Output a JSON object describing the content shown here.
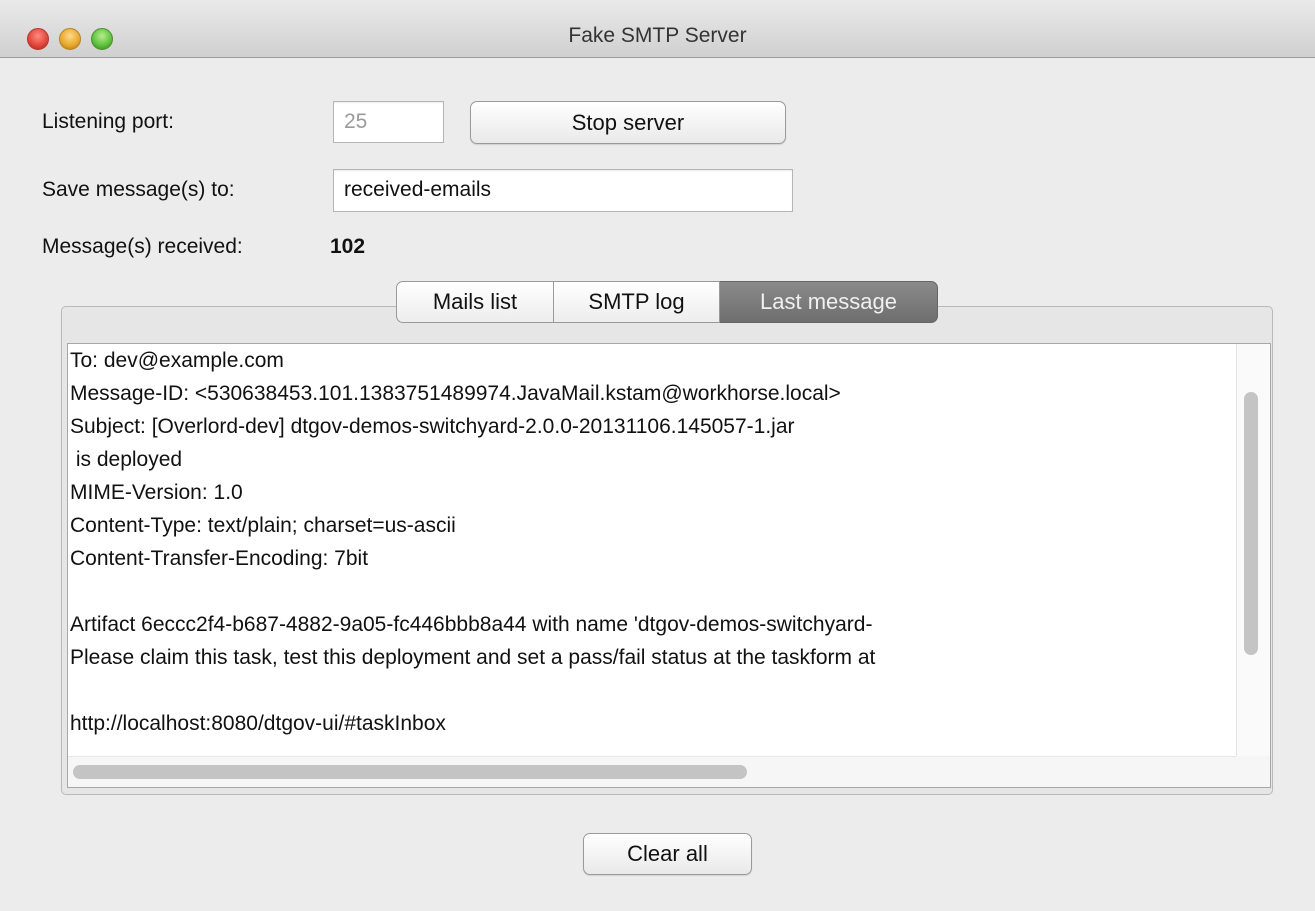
{
  "window": {
    "title": "Fake SMTP Server"
  },
  "form": {
    "listening_port_label": "Listening port:",
    "listening_port_value": "25",
    "stop_button_label": "Stop server",
    "save_label": "Save message(s) to:",
    "save_value": "received-emails",
    "received_label": "Message(s) received:",
    "received_count": "102"
  },
  "tabs": [
    {
      "label": "Mails list",
      "selected": false
    },
    {
      "label": "SMTP log",
      "selected": false
    },
    {
      "label": "Last message",
      "selected": true
    }
  ],
  "message": {
    "lines": [
      "To: dev@example.com",
      "Message-ID: <530638453.101.1383751489974.JavaMail.kstam@workhorse.local>",
      "Subject: [Overlord-dev] dtgov-demos-switchyard-2.0.0-20131106.145057-1.jar",
      " is deployed",
      "MIME-Version: 1.0",
      "Content-Type: text/plain; charset=us-ascii",
      "Content-Transfer-Encoding: 7bit",
      "",
      "Artifact 6eccc2f4-b687-4882-9a05-fc446bbb8a44 with name 'dtgov-demos-switchyard-",
      "Please claim this task, test this deployment and set a pass/fail status at the taskform at",
      "",
      "http://localhost:8080/dtgov-ui/#taskInbox"
    ]
  },
  "footer": {
    "clear_button_label": "Clear all"
  },
  "colors": {
    "window_bg": "#ececec",
    "selected_tab_bg": "#7a7a7a",
    "close_button": "#e0443a",
    "minimize_button": "#e6a72a",
    "maximize_button": "#5cbf3a"
  }
}
